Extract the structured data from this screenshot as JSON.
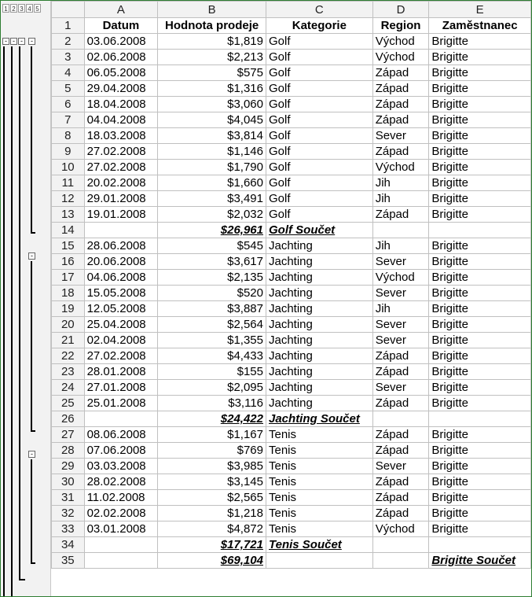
{
  "outline_levels": [
    "1",
    "2",
    "3",
    "4",
    "5"
  ],
  "columns": [
    "A",
    "B",
    "C",
    "D",
    "E"
  ],
  "header": {
    "num": "1",
    "cells": [
      "Datum",
      "Hodnota prodeje",
      "Kategorie",
      "Region",
      "Zaměstnanec"
    ]
  },
  "rows": [
    {
      "num": "2",
      "type": "data",
      "cells": [
        "03.06.2008",
        "$1,819",
        "Golf",
        "Východ",
        "Brigitte"
      ]
    },
    {
      "num": "3",
      "type": "data",
      "cells": [
        "02.06.2008",
        "$2,213",
        "Golf",
        "Východ",
        "Brigitte"
      ]
    },
    {
      "num": "4",
      "type": "data",
      "cells": [
        "06.05.2008",
        "$575",
        "Golf",
        "Západ",
        "Brigitte"
      ]
    },
    {
      "num": "5",
      "type": "data",
      "cells": [
        "29.04.2008",
        "$1,316",
        "Golf",
        "Západ",
        "Brigitte"
      ]
    },
    {
      "num": "6",
      "type": "data",
      "cells": [
        "18.04.2008",
        "$3,060",
        "Golf",
        "Západ",
        "Brigitte"
      ]
    },
    {
      "num": "7",
      "type": "data",
      "cells": [
        "04.04.2008",
        "$4,045",
        "Golf",
        "Západ",
        "Brigitte"
      ]
    },
    {
      "num": "8",
      "type": "data",
      "cells": [
        "18.03.2008",
        "$3,814",
        "Golf",
        "Sever",
        "Brigitte"
      ]
    },
    {
      "num": "9",
      "type": "data",
      "cells": [
        "27.02.2008",
        "$1,146",
        "Golf",
        "Západ",
        "Brigitte"
      ]
    },
    {
      "num": "10",
      "type": "data",
      "cells": [
        "27.02.2008",
        "$1,790",
        "Golf",
        "Východ",
        "Brigitte"
      ]
    },
    {
      "num": "11",
      "type": "data",
      "cells": [
        "20.02.2008",
        "$1,660",
        "Golf",
        "Jih",
        "Brigitte"
      ]
    },
    {
      "num": "12",
      "type": "data",
      "cells": [
        "29.01.2008",
        "$3,491",
        "Golf",
        "Jih",
        "Brigitte"
      ]
    },
    {
      "num": "13",
      "type": "data",
      "cells": [
        "19.01.2008",
        "$2,032",
        "Golf",
        "Západ",
        "Brigitte"
      ]
    },
    {
      "num": "14",
      "type": "subtotal",
      "cells": [
        "",
        "$26,961",
        "Golf Součet",
        "",
        ""
      ]
    },
    {
      "num": "15",
      "type": "data",
      "cells": [
        "28.06.2008",
        "$545",
        "Jachting",
        "Jih",
        "Brigitte"
      ]
    },
    {
      "num": "16",
      "type": "data",
      "cells": [
        "20.06.2008",
        "$3,617",
        "Jachting",
        "Sever",
        "Brigitte"
      ]
    },
    {
      "num": "17",
      "type": "data",
      "cells": [
        "04.06.2008",
        "$2,135",
        "Jachting",
        "Východ",
        "Brigitte"
      ]
    },
    {
      "num": "18",
      "type": "data",
      "cells": [
        "15.05.2008",
        "$520",
        "Jachting",
        "Sever",
        "Brigitte"
      ]
    },
    {
      "num": "19",
      "type": "data",
      "cells": [
        "12.05.2008",
        "$3,887",
        "Jachting",
        "Jih",
        "Brigitte"
      ]
    },
    {
      "num": "20",
      "type": "data",
      "cells": [
        "25.04.2008",
        "$2,564",
        "Jachting",
        "Sever",
        "Brigitte"
      ]
    },
    {
      "num": "21",
      "type": "data",
      "cells": [
        "02.04.2008",
        "$1,355",
        "Jachting",
        "Sever",
        "Brigitte"
      ]
    },
    {
      "num": "22",
      "type": "data",
      "cells": [
        "27.02.2008",
        "$4,433",
        "Jachting",
        "Západ",
        "Brigitte"
      ]
    },
    {
      "num": "23",
      "type": "data",
      "cells": [
        "28.01.2008",
        "$155",
        "Jachting",
        "Západ",
        "Brigitte"
      ]
    },
    {
      "num": "24",
      "type": "data",
      "cells": [
        "27.01.2008",
        "$2,095",
        "Jachting",
        "Sever",
        "Brigitte"
      ]
    },
    {
      "num": "25",
      "type": "data",
      "cells": [
        "25.01.2008",
        "$3,116",
        "Jachting",
        "Západ",
        "Brigitte"
      ]
    },
    {
      "num": "26",
      "type": "subtotal",
      "cells": [
        "",
        "$24,422",
        "Jachting Součet",
        "",
        ""
      ]
    },
    {
      "num": "27",
      "type": "data",
      "cells": [
        "08.06.2008",
        "$1,167",
        "Tenis",
        "Západ",
        "Brigitte"
      ]
    },
    {
      "num": "28",
      "type": "data",
      "cells": [
        "07.06.2008",
        "$769",
        "Tenis",
        "Západ",
        "Brigitte"
      ]
    },
    {
      "num": "29",
      "type": "data",
      "cells": [
        "03.03.2008",
        "$3,985",
        "Tenis",
        "Sever",
        "Brigitte"
      ]
    },
    {
      "num": "30",
      "type": "data",
      "cells": [
        "28.02.2008",
        "$3,145",
        "Tenis",
        "Západ",
        "Brigitte"
      ]
    },
    {
      "num": "31",
      "type": "data",
      "cells": [
        "11.02.2008",
        "$2,565",
        "Tenis",
        "Západ",
        "Brigitte"
      ]
    },
    {
      "num": "32",
      "type": "data",
      "cells": [
        "02.02.2008",
        "$1,218",
        "Tenis",
        "Západ",
        "Brigitte"
      ]
    },
    {
      "num": "33",
      "type": "data",
      "cells": [
        "03.01.2008",
        "$4,872",
        "Tenis",
        "Východ",
        "Brigitte"
      ]
    },
    {
      "num": "34",
      "type": "subtotal",
      "cells": [
        "",
        "$17,721",
        "Tenis Součet",
        "",
        ""
      ]
    },
    {
      "num": "35",
      "type": "subtotal",
      "cells": [
        "",
        "$69,104",
        "",
        "",
        "Brigitte Součet"
      ]
    }
  ]
}
